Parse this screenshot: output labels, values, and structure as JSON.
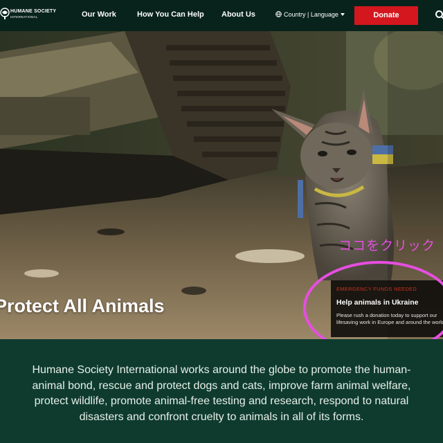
{
  "header": {
    "logo": {
      "line1": "HUMANE SOCIETY",
      "line2": "INTERNATIONAL"
    },
    "nav": [
      {
        "label": "Our Work"
      },
      {
        "label": "How You Can Help"
      },
      {
        "label": "About Us"
      }
    ],
    "country_language": "Country | Language",
    "donate_label": "Donate",
    "icons": {
      "globe": "globe-icon",
      "search": "search-icon",
      "caret": "caret-down-icon"
    }
  },
  "hero": {
    "title": "Protect All Animals",
    "annotation": "ココをクリック",
    "card": {
      "eyebrow": "EMERGENCY FUNDS NEEDED",
      "title": "Help animals in Ukraine",
      "body": "Please rush a donation today to support our lifesaving work in Europe and around the world"
    }
  },
  "mission": {
    "text": "Humane Society International works around the globe to promote the human-animal bond, rescue and protect dogs and cats, improve farm animal welfare, protect wildlife, promote animal-free testing and research, respond to natural disasters and confront cruelty to animals in all of its forms."
  },
  "colors": {
    "header_bg": "#08231c",
    "mission_bg": "#0e3b2e",
    "donate_bg": "#d4171f",
    "annotation": "#e64ee0"
  }
}
